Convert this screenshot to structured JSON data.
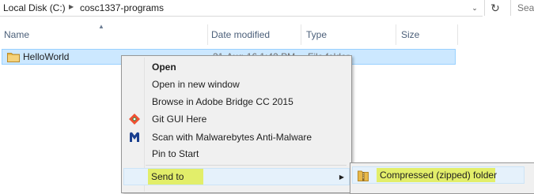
{
  "address_bar": {
    "crumbs": [
      "Local Disk (C:)",
      "cosc1337-programs"
    ],
    "separator_icon": "chevron-right-icon",
    "dropdown_icon": "chevron-down-icon",
    "refresh_icon": "refresh-icon"
  },
  "search": {
    "placeholder": "Sea"
  },
  "columns": [
    "Name",
    "Date modified",
    "Type",
    "Size"
  ],
  "files": [
    {
      "name": "HelloWorld",
      "date_modified": "31-Aug-16 1:42 PM",
      "type": "File folder",
      "icon": "folder-icon"
    }
  ],
  "context_menu": {
    "items": [
      {
        "label": "Open",
        "bold": true
      },
      {
        "label": "Open in new window"
      },
      {
        "label": "Browse in Adobe Bridge CC 2015"
      },
      {
        "label": "Git GUI Here",
        "icon": "git-icon"
      },
      {
        "label": "Scan with Malwarebytes Anti-Malware",
        "icon": "malwarebytes-icon"
      },
      {
        "label": "Pin to Start"
      },
      {
        "label": "Send to",
        "submenu": true,
        "highlighted": true
      }
    ]
  },
  "send_to_submenu": {
    "items": [
      {
        "label": "Compressed (zipped) folder",
        "icon": "zip-folder-icon",
        "highlighted": true
      }
    ]
  },
  "colors": {
    "selection_bg": "#cce8ff",
    "selection_border": "#99d1ff",
    "menu_bg": "#f0f0f0",
    "highlighter": "#e2ee6a",
    "header_text": "#4c607a"
  }
}
